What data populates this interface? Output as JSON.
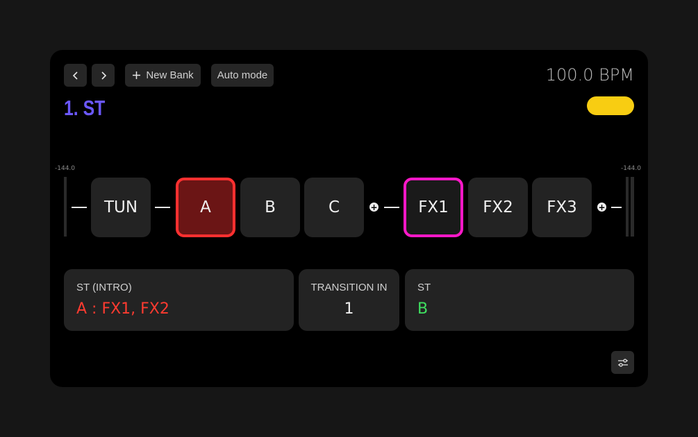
{
  "toolbar": {
    "prev_icon": "chevron-left-icon",
    "next_icon": "chevron-right-icon",
    "new_bank_label": "New Bank",
    "auto_mode_label": "Auto mode"
  },
  "header": {
    "bpm": "100.0 BPM",
    "bank_title": "1. ST",
    "title_color": "#6b58ff",
    "status_color": "#f8cd12"
  },
  "chain": {
    "input_meter_label": "-144.0",
    "output_meter_label": "-144.0",
    "blocks": [
      {
        "label": "TUN"
      },
      {
        "label": "A",
        "selected_color": "#ff3030"
      },
      {
        "label": "B"
      },
      {
        "label": "C"
      },
      {
        "label": "FX1",
        "selected_color": "#ff18c8"
      },
      {
        "label": "FX2"
      },
      {
        "label": "FX3"
      }
    ]
  },
  "cards": {
    "intro": {
      "label": "ST (INTRO)",
      "value": "A : FX1, FX2"
    },
    "transition": {
      "label": "TRANSITION IN",
      "value": "1"
    },
    "scene": {
      "label": "ST",
      "value": "B"
    }
  },
  "footer": {
    "settings_icon": "sliders-icon"
  }
}
